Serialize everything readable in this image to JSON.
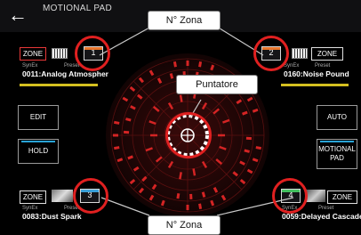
{
  "titlebar": {
    "back": "←",
    "title": "MOTIONAL PAD"
  },
  "zones": {
    "top_left": {
      "zone_label": "ZONE",
      "number": "1",
      "stripe": "#e8742a",
      "kind": "SynEx",
      "preset": "Preset",
      "name": "0011:Analog Atmospher"
    },
    "top_right": {
      "zone_label": "ZONE",
      "number": "2",
      "stripe": "#e8742a",
      "kind": "SynEx",
      "preset": "Preset",
      "name": "0160:Noise Pound"
    },
    "bottom_left": {
      "zone_label": "ZONE",
      "number": "3",
      "stripe": "#3aa0d8",
      "kind": "SynEx",
      "preset": "Preset",
      "name": "0083:Dust Spark"
    },
    "bottom_right": {
      "zone_label": "ZONE",
      "number": "4",
      "stripe": "#44c060",
      "kind": "SynEx",
      "preset": "Preset",
      "name": "0059:Delayed Cascade"
    }
  },
  "buttons": {
    "edit": "EDIT",
    "hold": "HOLD",
    "auto": "AUTO",
    "motional_pad": "MOTIONAL PAD"
  },
  "callouts": {
    "zone_top": "N° Zona",
    "pointer": "Puntatore",
    "zone_bottom": "N° Zona"
  },
  "colors": {
    "accent_red": "#e02020",
    "pad_red": "#d42424",
    "tone_bar": "#d4c020"
  }
}
